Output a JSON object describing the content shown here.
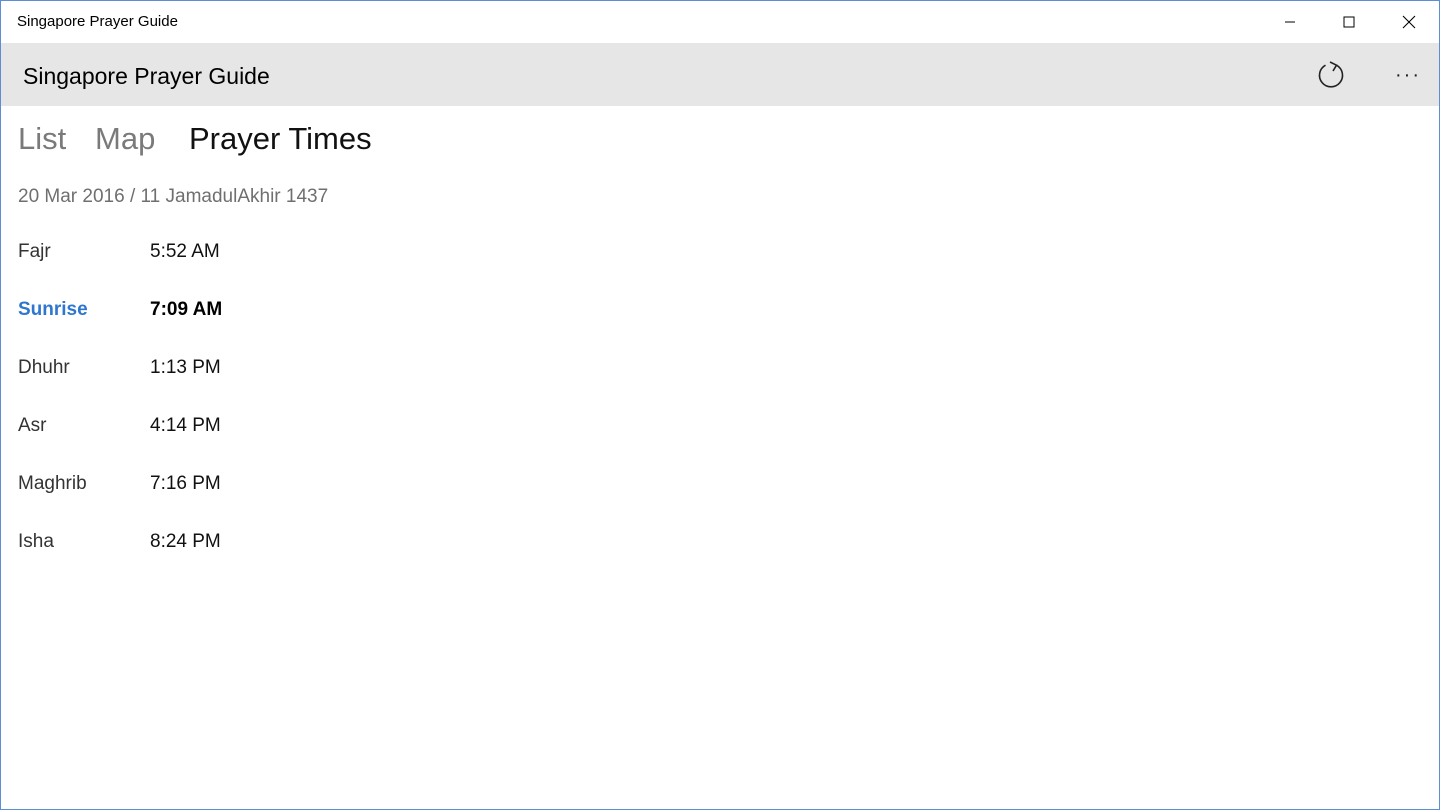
{
  "window": {
    "title": "Singapore Prayer Guide"
  },
  "appbar": {
    "title": "Singapore Prayer Guide",
    "refresh_icon": "refresh-icon",
    "more_label": "···"
  },
  "tabs": [
    {
      "label": "List",
      "selected": false
    },
    {
      "label": "Map",
      "selected": false
    },
    {
      "label": "Prayer Times",
      "selected": true
    }
  ],
  "date_line": "20 Mar 2016 / 11 JamadulAkhir 1437",
  "prayers": [
    {
      "name": "Fajr",
      "time": "5:52 AM",
      "active": false
    },
    {
      "name": "Sunrise",
      "time": "7:09 AM",
      "active": true
    },
    {
      "name": "Dhuhr",
      "time": "1:13 PM",
      "active": false
    },
    {
      "name": "Asr",
      "time": "4:14 PM",
      "active": false
    },
    {
      "name": "Maghrib",
      "time": "7:16 PM",
      "active": false
    },
    {
      "name": "Isha",
      "time": "8:24 PM",
      "active": false
    }
  ],
  "colors": {
    "accent": "#2f76cf",
    "appbar_bg": "#e6e6e6",
    "window_border": "#5a8fd6"
  }
}
